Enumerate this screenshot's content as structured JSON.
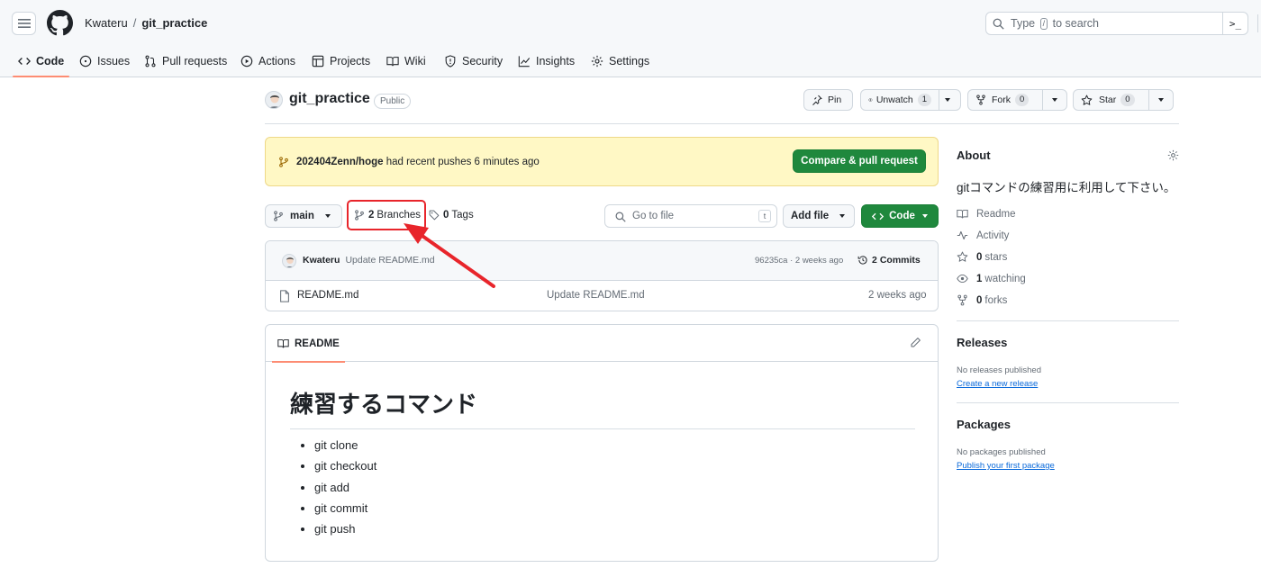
{
  "header": {
    "owner": "Kwateru",
    "separator": "/",
    "repo": "git_practice",
    "search": {
      "prefix": "Type",
      "key": "/",
      "suffix": "to search"
    },
    "terminal_label": ">_"
  },
  "tabs": [
    {
      "label": "Code",
      "icon": "code-icon",
      "active": true
    },
    {
      "label": "Issues",
      "icon": "issue-icon"
    },
    {
      "label": "Pull requests",
      "icon": "pull-request-icon"
    },
    {
      "label": "Actions",
      "icon": "play-icon"
    },
    {
      "label": "Projects",
      "icon": "table-icon"
    },
    {
      "label": "Wiki",
      "icon": "book-icon"
    },
    {
      "label": "Security",
      "icon": "shield-icon"
    },
    {
      "label": "Insights",
      "icon": "graph-icon"
    },
    {
      "label": "Settings",
      "icon": "gear-icon"
    }
  ],
  "repo_header": {
    "name": "git_practice",
    "visibility": "Public",
    "pin_label": "Pin",
    "unwatch_label": "Unwatch",
    "unwatch_count": "1",
    "fork_label": "Fork",
    "fork_count": "0",
    "star_label": "Star",
    "star_count": "0"
  },
  "banner": {
    "branch": "202404Zenn/hoge",
    "message": "had recent pushes 6 minutes ago",
    "button": "Compare & pull request"
  },
  "file_nav": {
    "branch": "main",
    "branches_count": "2",
    "branches_label": "Branches",
    "tags_count": "0",
    "tags_label": "Tags",
    "goto_placeholder": "Go to file",
    "goto_key": "t",
    "add_file": "Add file",
    "code_button": "Code"
  },
  "latest_commit": {
    "author": "Kwateru",
    "message": "Update README.md",
    "meta": "96235ca · 2 weeks ago",
    "commits_count": "2",
    "commits_label": "Commits"
  },
  "files": [
    {
      "name": "README.md",
      "commit": "Update README.md",
      "age": "2 weeks ago"
    }
  ],
  "readme": {
    "tab": "README",
    "heading": "練習するコマンド",
    "items": [
      "git clone",
      "git checkout",
      "git add",
      "git commit",
      "git push"
    ]
  },
  "about": {
    "title": "About",
    "description": "gitコマンドの練習用に利用して下さい。",
    "readme": "Readme",
    "activity": "Activity",
    "stars_count": "0",
    "stars_label": "stars",
    "watching_count": "1",
    "watching_label": "watching",
    "forks_count": "0",
    "forks_label": "forks"
  },
  "releases": {
    "title": "Releases",
    "empty": "No releases published",
    "link": "Create a new release"
  },
  "packages": {
    "title": "Packages",
    "empty": "No packages published",
    "link": "Publish your first package"
  },
  "colors": {
    "accent_green": "#1f883d",
    "tab_underline": "#fd8c73",
    "annotation_red": "#e8252b",
    "banner_bg": "#fff8c5",
    "link_blue": "#0969da"
  }
}
